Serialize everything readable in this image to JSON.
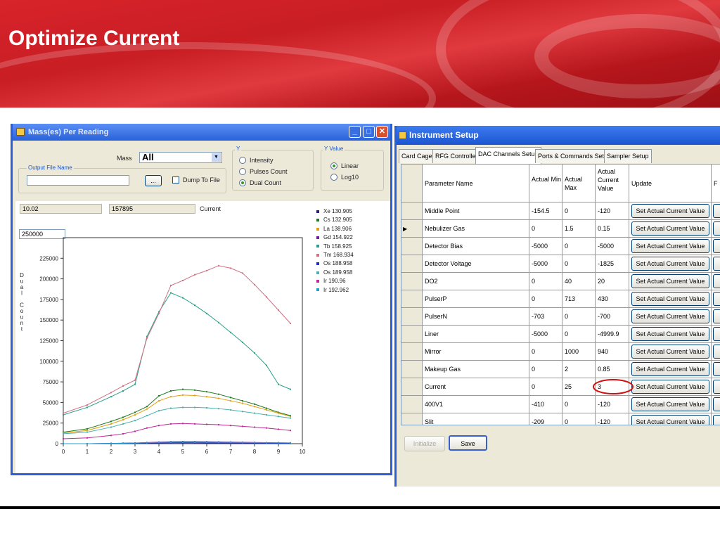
{
  "slide": {
    "title": "Optimize Current"
  },
  "mass_window": {
    "title": "Mass(es) Per Reading",
    "mass_label": "Mass",
    "mass_value": "All",
    "output_legend": "Output File Name",
    "output_value": "",
    "browse_label": "...",
    "dump_label": "Dump To File",
    "y_legend": "Y",
    "y_options": [
      "Intensity",
      "Pulses Count",
      "Dual Count"
    ],
    "y_selected": "Dual Count",
    "yvalue_legend": "Y Value",
    "yvalue_options": [
      "Linear",
      "Log10"
    ],
    "yvalue_selected": "Linear",
    "readout_1": "10.02",
    "readout_2": "157895",
    "readout_label": "Current",
    "ymax_box": "250000"
  },
  "chart_data": {
    "type": "line",
    "ylabel": "Dual Count",
    "xlim": [
      0,
      10
    ],
    "ylim": [
      0,
      250000
    ],
    "xticks": [
      "0",
      "1",
      "2",
      "3",
      "4",
      "5",
      "6",
      "7",
      "8",
      "9",
      "10"
    ],
    "yticks": [
      "0",
      "25000",
      "50000",
      "75000",
      "100000",
      "125000",
      "150000",
      "175000",
      "200000",
      "225000"
    ],
    "legend_position": "right",
    "x": [
      0,
      1,
      2,
      2.5,
      3,
      3.5,
      4,
      4.5,
      5,
      5.5,
      6,
      6.5,
      7,
      7.5,
      8,
      8.5,
      9,
      9.5
    ],
    "series": [
      {
        "name": "Xe 130.905",
        "color": "#2b1e7a",
        "values": [
          0,
          0,
          200,
          400,
          700,
          1000,
          1200,
          1300,
          1300,
          1250,
          1200,
          1100,
          1000,
          900,
          800,
          700,
          600,
          500
        ]
      },
      {
        "name": "Cs 132.905",
        "color": "#1e7a1e",
        "values": [
          14000,
          18000,
          27000,
          32000,
          38000,
          45000,
          58000,
          64000,
          66000,
          65000,
          63000,
          60000,
          56000,
          52000,
          48000,
          43000,
          38000,
          34000
        ]
      },
      {
        "name": "La 138.906",
        "color": "#e0a010",
        "values": [
          13000,
          16000,
          24000,
          29000,
          35000,
          42000,
          52000,
          57000,
          59000,
          58500,
          57000,
          55000,
          52000,
          49000,
          45000,
          41000,
          37000,
          33000
        ]
      },
      {
        "name": "Gd 154.922",
        "color": "#6a1fa0",
        "values": [
          0,
          0,
          300,
          600,
          900,
          1400,
          1900,
          2300,
          2500,
          2400,
          2300,
          2100,
          1900,
          1700,
          1500,
          1300,
          1100,
          900
        ]
      },
      {
        "name": "Tb 158.925",
        "color": "#2aa08a",
        "values": [
          35000,
          44000,
          57000,
          64000,
          72000,
          130000,
          160000,
          183000,
          177000,
          168000,
          158000,
          147000,
          135000,
          123000,
          110000,
          95000,
          72000,
          66000
        ]
      },
      {
        "name": "Tm 168.934",
        "color": "#d07080",
        "values": [
          37000,
          47000,
          62000,
          70000,
          77000,
          128000,
          158000,
          192000,
          198000,
          205000,
          210000,
          216000,
          213000,
          207000,
          193000,
          178000,
          162000,
          146000
        ]
      },
      {
        "name": "Os 188.958",
        "color": "#1e30c0",
        "values": [
          0,
          0,
          100,
          300,
          500,
          700,
          900,
          1000,
          1000,
          950,
          900,
          850,
          800,
          700,
          600,
          500,
          400,
          300
        ]
      },
      {
        "name": "Os 189.958",
        "color": "#4ab0b0",
        "values": [
          12000,
          14000,
          20000,
          24000,
          28000,
          34000,
          40000,
          43000,
          44000,
          44000,
          43500,
          42500,
          41000,
          39000,
          37000,
          35000,
          33000,
          31000
        ]
      },
      {
        "name": "Ir 190.96",
        "color": "#c02a9a",
        "values": [
          6000,
          7000,
          10000,
          12000,
          15000,
          19000,
          22000,
          24000,
          24500,
          24000,
          23500,
          23000,
          22000,
          21000,
          20000,
          19000,
          17500,
          16000
        ]
      },
      {
        "name": "Ir 192.962",
        "color": "#1ea0d0",
        "values": [
          0,
          0,
          200,
          500,
          800,
          1200,
          1500,
          1700,
          1800,
          1750,
          1700,
          1600,
          1500,
          1400,
          1300,
          1200,
          1100,
          1000
        ]
      }
    ]
  },
  "inst_window": {
    "title": "Instrument Setup",
    "tabs": [
      "Card Cage",
      "RFG Controller",
      "DAC Channels Setup",
      "Ports & Commands Setup",
      "Sampler Setup"
    ],
    "active_tab": "DAC Channels Setup",
    "columns": [
      "Parameter Name",
      "Actual Min",
      "Actual Max",
      "Actual Current Value",
      "Update",
      "F"
    ],
    "rows": [
      {
        "name": "Middle Point",
        "min": "-154.5",
        "max": "0",
        "cur": "-120"
      },
      {
        "name": "Nebulizer Gas",
        "min": "0",
        "max": "1.5",
        "cur": "0.15"
      },
      {
        "name": "Detector Bias",
        "min": "-5000",
        "max": "0",
        "cur": "-5000"
      },
      {
        "name": "Detector Voltage",
        "min": "-5000",
        "max": "0",
        "cur": "-1825"
      },
      {
        "name": "DO2",
        "min": "0",
        "max": "40",
        "cur": "20"
      },
      {
        "name": "PulserP",
        "min": "0",
        "max": "713",
        "cur": "430"
      },
      {
        "name": "PulserN",
        "min": "-703",
        "max": "0",
        "cur": "-700"
      },
      {
        "name": "Liner",
        "min": "-5000",
        "max": "0",
        "cur": "-4999.9"
      },
      {
        "name": "Mirror",
        "min": "0",
        "max": "1000",
        "cur": "940"
      },
      {
        "name": "Makeup Gas",
        "min": "0",
        "max": "2",
        "cur": "0.85"
      },
      {
        "name": "Current",
        "min": "0",
        "max": "25",
        "cur": "3"
      },
      {
        "name": "400V1",
        "min": "-410",
        "max": "0",
        "cur": "-120"
      },
      {
        "name": "Slit",
        "min": "-209",
        "max": "0",
        "cur": "-120"
      }
    ],
    "set_button_label": "Set Actual Current Value",
    "initialize_label": "Initialize",
    "save_label": "Save",
    "highlight_color": "#d01010"
  }
}
